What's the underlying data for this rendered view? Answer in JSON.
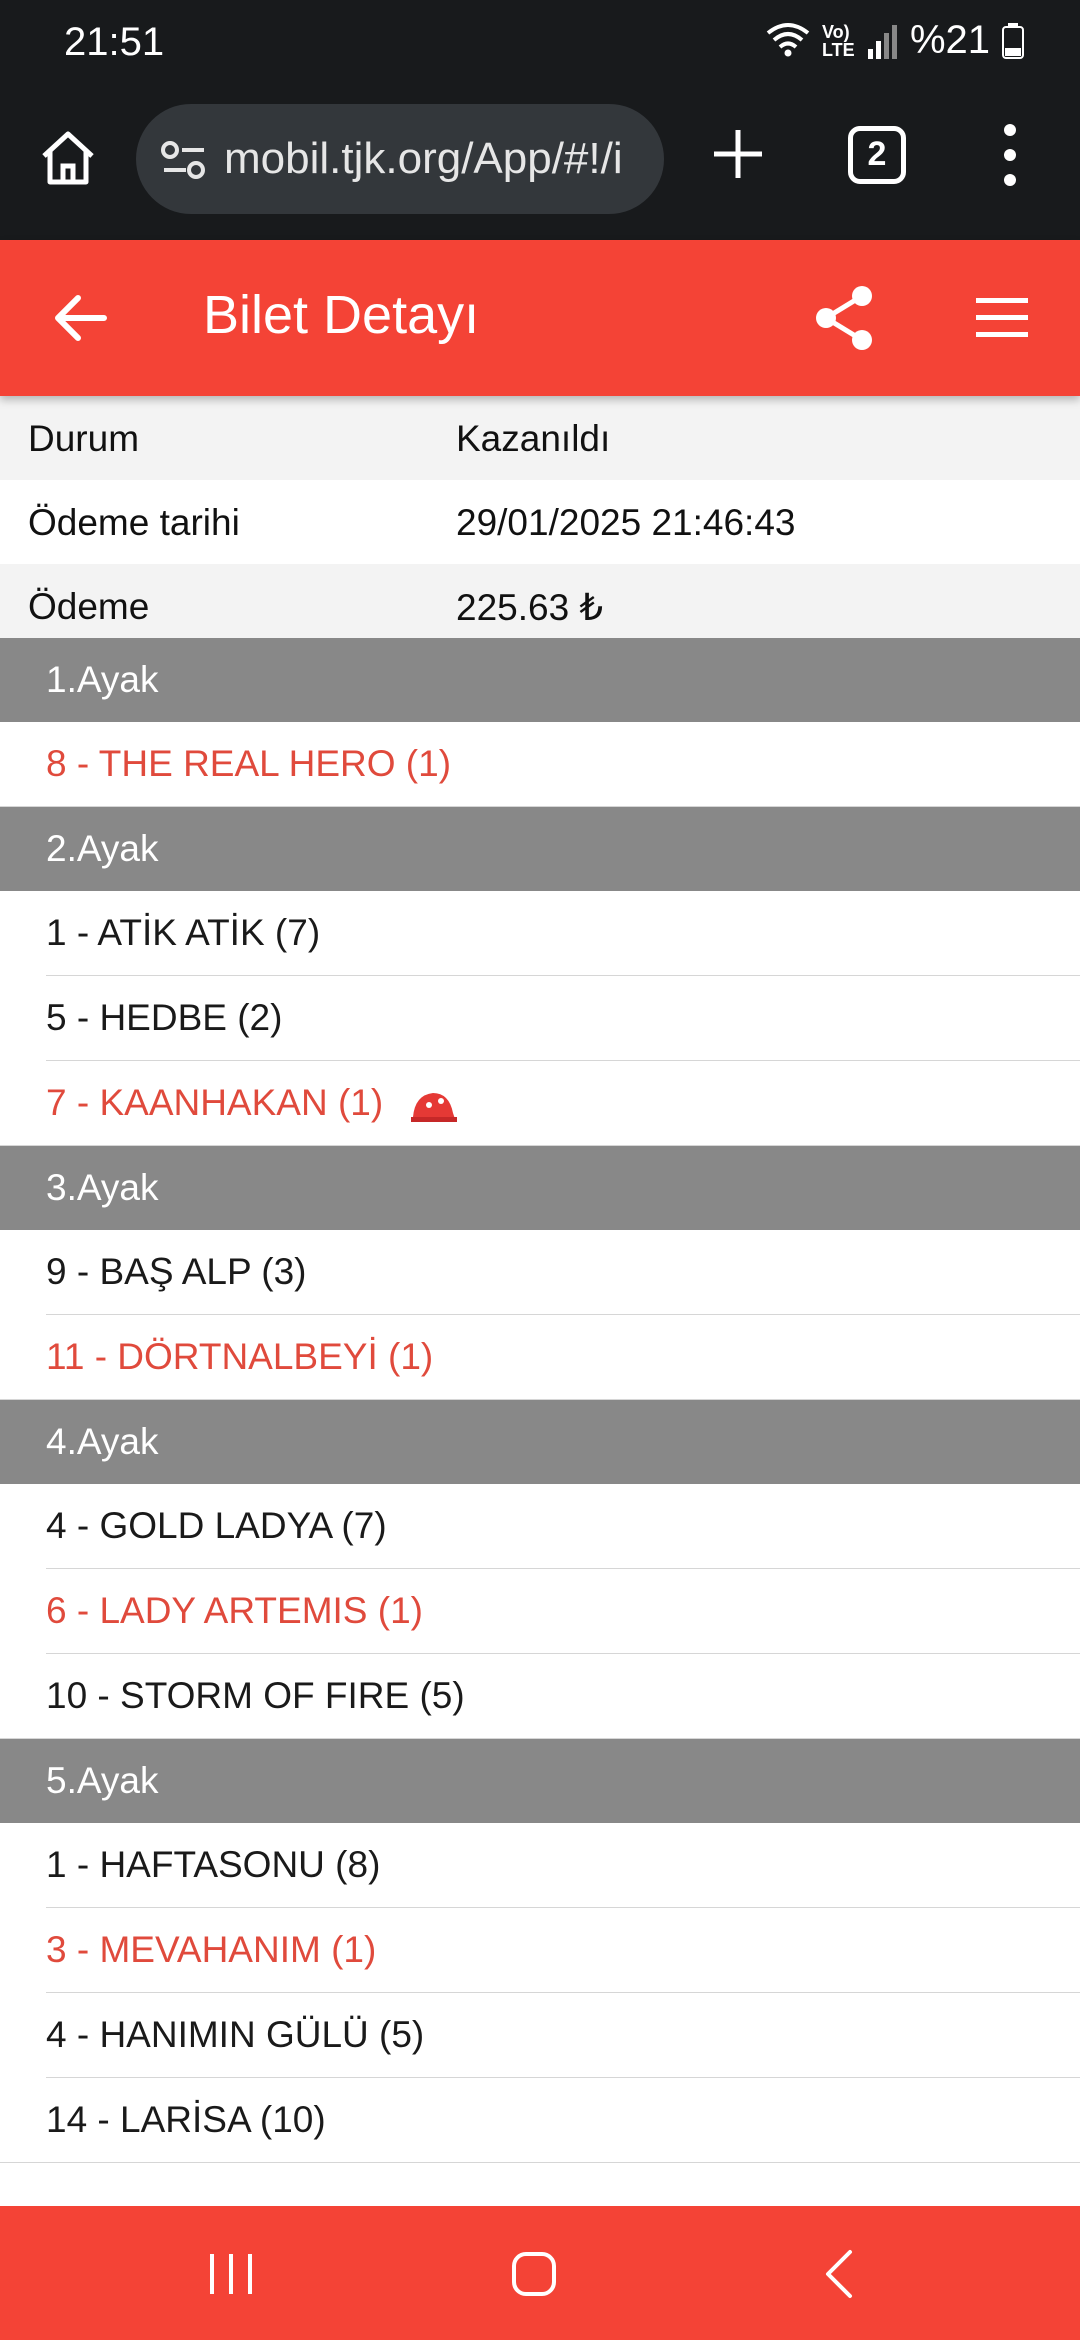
{
  "status_bar": {
    "time": "21:51",
    "network": "Vo) LTE",
    "battery": "%21"
  },
  "browser": {
    "url": "mobil.tjk.org/App/#!/i",
    "tab_count": "2"
  },
  "header": {
    "title": "Bilet Detayı"
  },
  "info": [
    {
      "label": "Durum",
      "value": "Kazanıldı"
    },
    {
      "label": "Ödeme tarihi",
      "value": "29/01/2025 21:46:43"
    },
    {
      "label": "Ödeme",
      "value": "225.63 ₺"
    }
  ],
  "legs": [
    {
      "title": "1.Ayak",
      "horses": [
        {
          "text": "8 - THE REAL HERO (1)",
          "winner": true
        }
      ]
    },
    {
      "title": "2.Ayak",
      "horses": [
        {
          "text": "1 - ATİK ATİK (7)",
          "winner": false
        },
        {
          "text": "5 - HEDBE (2)",
          "winner": false
        },
        {
          "text": "7 - KAANHAKAN (1)",
          "winner": true,
          "mark": "red-cap-icon"
        }
      ]
    },
    {
      "title": "3.Ayak",
      "horses": [
        {
          "text": "9 - BAŞ ALP (3)",
          "winner": false
        },
        {
          "text": "11 - DÖRTNALBEYİ (1)",
          "winner": true
        }
      ]
    },
    {
      "title": "4.Ayak",
      "horses": [
        {
          "text": "4 - GOLD LADYA (7)",
          "winner": false
        },
        {
          "text": "6 - LADY ARTEMIS (1)",
          "winner": true
        },
        {
          "text": "10 - STORM OF FIRE (5)",
          "winner": false
        }
      ]
    },
    {
      "title": "5.Ayak",
      "horses": [
        {
          "text": "1 - HAFTASONU (8)",
          "winner": false
        },
        {
          "text": "3 - MEVAHANIM (1)",
          "winner": true
        },
        {
          "text": "4 - HANIMIN GÜLÜ (5)",
          "winner": false
        },
        {
          "text": "14 - LARİSA (10)",
          "winner": false
        }
      ]
    }
  ],
  "colors": {
    "accent": "#f44336",
    "winner_text": "#e04a3c",
    "leg_header": "#888888",
    "system_bar": "#181a1c"
  }
}
